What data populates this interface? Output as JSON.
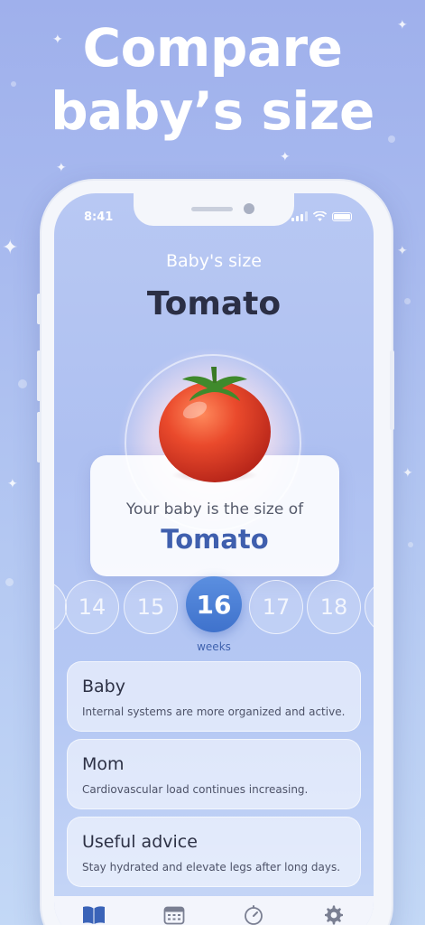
{
  "headline": {
    "line1": "Compare",
    "line2": "baby’s size"
  },
  "status_bar": {
    "time": "8:41"
  },
  "screen": {
    "size_label": "Baby's size",
    "fruit_title": "Tomato",
    "card": {
      "line1": "Your baby is the size of",
      "line2": "Tomato"
    }
  },
  "weeks": {
    "items": [
      "14",
      "15",
      "16",
      "17",
      "18"
    ],
    "selected": "16",
    "label": "weeks"
  },
  "sections": [
    {
      "title": "Baby",
      "description": "Internal systems are more organized and active."
    },
    {
      "title": "Mom",
      "description": "Cardiovascular load continues increasing."
    },
    {
      "title": "Useful advice",
      "description": "Stay hydrated and elevate legs after long days."
    }
  ],
  "tabbar": {
    "tabs": [
      {
        "icon": "book-icon",
        "active": true
      },
      {
        "icon": "calendar-icon",
        "active": false
      },
      {
        "icon": "timer-icon",
        "active": false
      },
      {
        "icon": "gear-icon",
        "active": false
      }
    ]
  },
  "colors": {
    "accent": "#3f72cc",
    "title_text": "#2b2f45",
    "card_highlight": "#3f5fae",
    "tomato": "#e2402a"
  }
}
